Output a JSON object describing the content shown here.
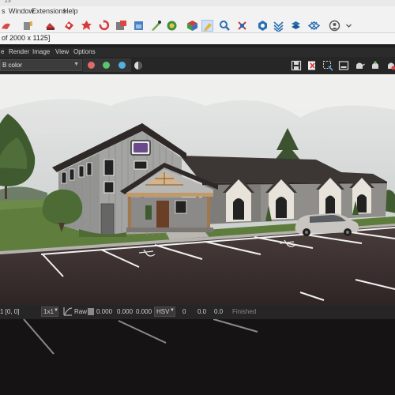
{
  "window": {
    "title_fragment": "23"
  },
  "menu": {
    "items": [
      "s",
      "Window",
      "Extensions",
      "Help"
    ]
  },
  "toolbar": {
    "icons": [
      "shape-icon",
      "brush-icon",
      "stamp-icon",
      "flower-icon",
      "rotate-icon",
      "box-icon",
      "building-icon",
      "pencil-icon",
      "sphere-icon",
      "cube-icon",
      "path-select-icon",
      "magnify-icon",
      "move-icon",
      "target-icon",
      "snowflake-icon",
      "layers-icon",
      "diamond-icon",
      "user-icon"
    ]
  },
  "info": {
    "resolution": "of 2000 x 1125]"
  },
  "render_menu": {
    "items": [
      "e",
      "Render",
      "Image",
      "View",
      "Options"
    ]
  },
  "controls": {
    "color_mode": "B color",
    "channel_colors": [
      "#e06a6a",
      "#57c66e",
      "#4fb3e0"
    ]
  },
  "status": {
    "coords": "1  [0, 0]",
    "zoom": "1x1",
    "raw_label": "Raw",
    "rgb": [
      "0.000",
      "0.000",
      "0.000"
    ],
    "colorspace": "HSV",
    "hsv": [
      "0",
      "0.0",
      "0.0"
    ],
    "state": "Finished"
  }
}
